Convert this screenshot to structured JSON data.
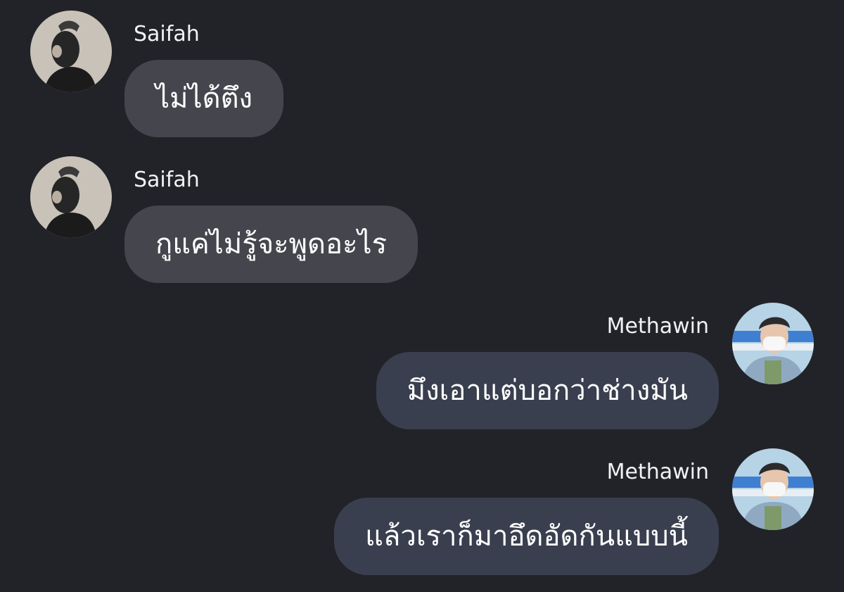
{
  "messages": [
    {
      "direction": "incoming",
      "sender": "Saifah",
      "text": "ไม่ได้ตึง",
      "avatar_icon": "user-avatar-icon"
    },
    {
      "direction": "incoming",
      "sender": "Saifah",
      "text": "กูแค่ไม่รู้จะพูดอะไร",
      "avatar_icon": "user-avatar-icon"
    },
    {
      "direction": "outgoing",
      "sender": "Methawin",
      "text": "มึงเอาแต่บอกว่าช่างมัน",
      "avatar_icon": "user-avatar-icon"
    },
    {
      "direction": "outgoing",
      "sender": "Methawin",
      "text": "แล้วเราก็มาอึดอัดกันแบบนี้",
      "avatar_icon": "user-avatar-icon"
    }
  ],
  "colors": {
    "background": "#222328",
    "incoming_bubble": "#45464d",
    "outgoing_bubble": "#3a3f4f",
    "text": "#ffffff"
  }
}
